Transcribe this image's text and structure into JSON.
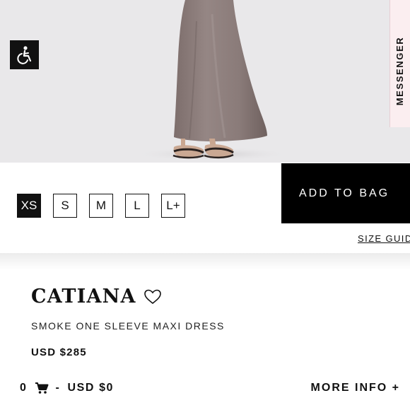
{
  "accessibility": {
    "icon": "wheelchair-icon"
  },
  "messenger": {
    "label": "MESSENGER"
  },
  "sizes": [
    "XS",
    "S",
    "M",
    "L",
    "L+"
  ],
  "selected_size": "XS",
  "add_to_bag": {
    "label": "ADD TO BAG"
  },
  "size_guide": {
    "label": "SIZE GUID"
  },
  "product": {
    "brand": "CATIANA",
    "name": "SMOKE ONE SLEEVE MAXI DRESS",
    "price": "USD $285"
  },
  "cart": {
    "count": "0",
    "separator": "-",
    "total": "USD $0",
    "icon": "cart-icon"
  },
  "more_info": {
    "label": "MORE INFO +"
  },
  "colors": {
    "accent": "#000000",
    "dress": "#8a7a78",
    "background": "#e9e8ea",
    "messenger_bg": "#fbeef0"
  }
}
